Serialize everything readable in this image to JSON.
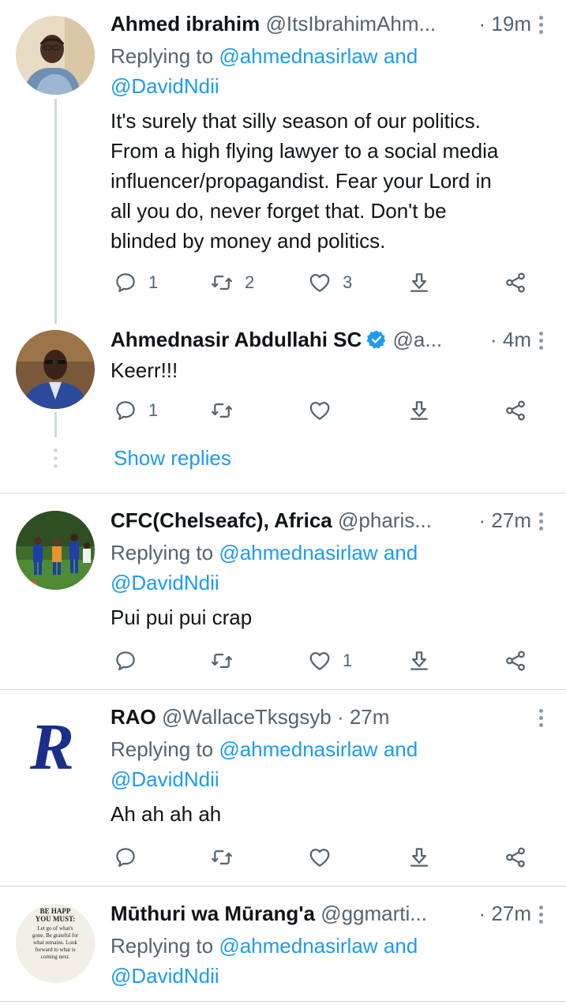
{
  "tweets": [
    {
      "name": "Ahmed ibrahim",
      "handle": "@ItsIbrahimAhm...",
      "time": "· 19m",
      "replying_prefix": "Replying to",
      "replying_user1": "@ahmednasirlaw",
      "replying_and": "and",
      "replying_user2": "@DavidNdii",
      "text_lines": [
        "It's surely that silly season of our politics.",
        "From a high flying lawyer to a social media",
        "influencer/propagandist. Fear your Lord in",
        "all you do, never forget that. Don't be",
        "blinded by money and politics."
      ],
      "replies": "1",
      "retweets": "2",
      "likes": "3"
    },
    {
      "name": "Ahmednasir Abdullahi SC",
      "handle": "@a...",
      "time": "· 4m",
      "verified": true,
      "text": "Keerr!!!",
      "replies": "1",
      "retweets": "",
      "likes": ""
    },
    {
      "name": "CFC(Chelseafc), Africa",
      "handle": "@pharis...",
      "time": "· 27m",
      "replying_prefix": "Replying to",
      "replying_user1": "@ahmednasirlaw",
      "replying_and": "and",
      "replying_user2": "@DavidNdii",
      "text": "Pui pui pui crap",
      "replies": "",
      "retweets": "",
      "likes": "1"
    },
    {
      "name": "RAO",
      "handle": "@WallaceTksgsyb · 27m",
      "replying_prefix": "Replying to",
      "replying_user1": "@ahmednasirlaw",
      "replying_and": "and",
      "replying_user2": "@DavidNdii",
      "text": "Ah ah ah ah"
    },
    {
      "name": "Mūthuri wa Mūrang'a",
      "handle": "@ggmarti...",
      "time": "· 27m",
      "replying_prefix": "Replying to",
      "replying_user1": "@ahmednasirlaw",
      "replying_and": "and",
      "replying_user2": "@DavidNdii"
    }
  ],
  "show_replies_label": "Show replies",
  "avatar_texts": {
    "rao_letter": "R",
    "quote_lines": [
      "BE HAPP",
      "YOU MUST:",
      "Let go of what's",
      "gone. Be grateful for",
      "what remains. Look",
      "forward to what is",
      "coming next."
    ]
  },
  "colors": {
    "link": "#1d9bf0",
    "secondary": "#536471",
    "divider": "#cfd9de",
    "verified": "#1d9bf0"
  },
  "icons": [
    "reply-icon",
    "retweet-icon",
    "like-icon",
    "download-icon",
    "share-icon",
    "more-icon",
    "verified-badge-icon"
  ]
}
